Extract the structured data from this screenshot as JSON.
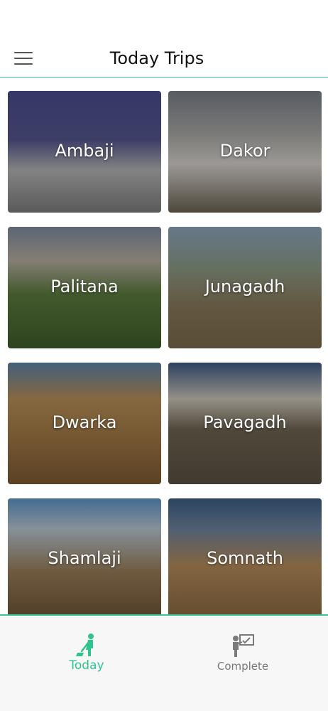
{
  "header": {
    "title": "Today Trips",
    "menu_icon": "hamburger-menu-icon"
  },
  "trips": [
    {
      "name": "Ambaji"
    },
    {
      "name": "Dakor"
    },
    {
      "name": "Palitana"
    },
    {
      "name": "Junagadh"
    },
    {
      "name": "Dwarka"
    },
    {
      "name": "Pavagadh"
    },
    {
      "name": "Shamlaji"
    },
    {
      "name": "Somnath"
    }
  ],
  "bottom_nav": {
    "tabs": [
      {
        "label": "Today",
        "icon": "person-sweeping-icon",
        "active": true
      },
      {
        "label": "Complete",
        "icon": "presenter-board-icon",
        "active": false
      }
    ]
  },
  "colors": {
    "accent": "#2fc48d",
    "inactive": "#777777",
    "nav_background": "#f7f7f7"
  }
}
